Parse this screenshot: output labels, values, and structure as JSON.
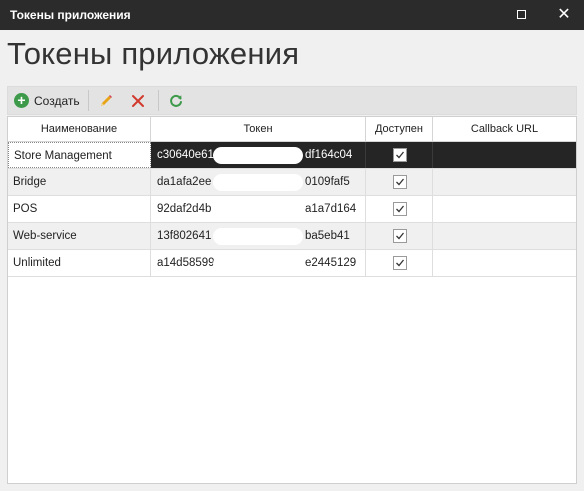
{
  "window": {
    "title": "Токены приложения",
    "maximize_icon": "maximize-icon",
    "close_label": "✕"
  },
  "page": {
    "heading": "Токены приложения"
  },
  "toolbar": {
    "create_label": "Создать",
    "create_icon": "plus-circle-icon",
    "edit_icon": "pencil-icon",
    "delete_icon": "x-icon",
    "refresh_icon": "refresh-icon"
  },
  "table": {
    "columns": [
      "Наименование",
      "Токен",
      "Доступен",
      "Callback URL"
    ],
    "rows": [
      {
        "name": "Store Management",
        "token_start": "c30640e61",
        "token_end": "df164c04",
        "available": true,
        "callback": ""
      },
      {
        "name": "Bridge",
        "token_start": "da1afa2ee",
        "token_end": "0109faf5",
        "available": true,
        "callback": ""
      },
      {
        "name": "POS",
        "token_start": "92daf2d4b",
        "token_end": "a1a7d164",
        "available": true,
        "callback": ""
      },
      {
        "name": "Web-service",
        "token_start": "13f802641",
        "token_end": "ba5eb41",
        "available": true,
        "callback": ""
      },
      {
        "name": "Unlimited",
        "token_start": "a14d58599",
        "token_end": "e2445129",
        "available": true,
        "callback": ""
      }
    ],
    "selected_row": 0
  },
  "colors": {
    "titlebar": "#2b2b2b",
    "selected_row": "#252525",
    "create_icon": "#3d9a4b",
    "delete_icon": "#d23a2f",
    "refresh_icon": "#3d9a4b",
    "edit_icon": "#e8a317"
  }
}
